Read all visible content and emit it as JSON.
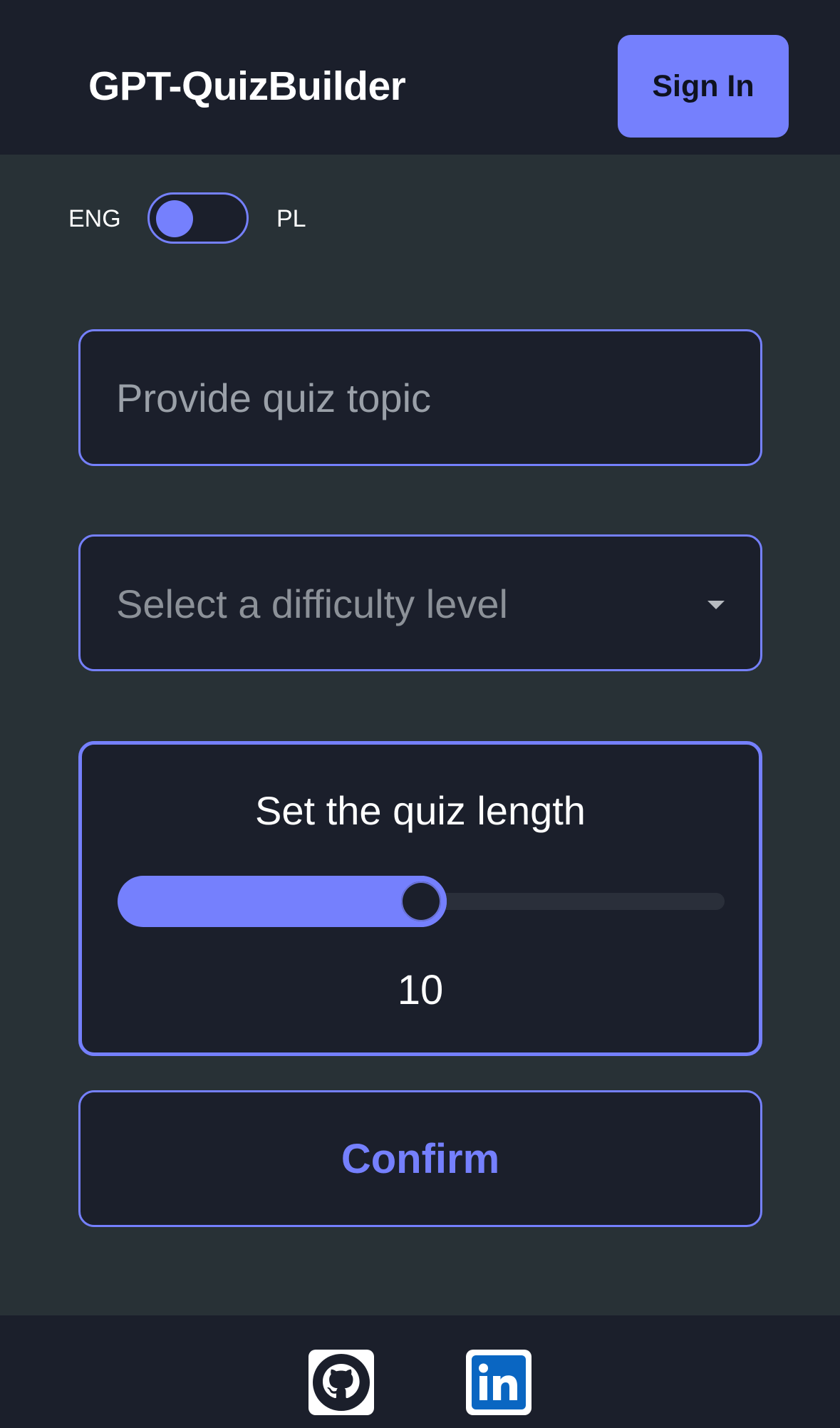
{
  "header": {
    "app_title": "GPT-QuizBuilder",
    "sign_in_label": "Sign In"
  },
  "language": {
    "left_label": "ENG",
    "right_label": "PL",
    "selected": "ENG"
  },
  "form": {
    "topic": {
      "placeholder": "Provide quiz topic",
      "value": ""
    },
    "difficulty": {
      "placeholder": "Select a difficulty level"
    },
    "length": {
      "title": "Set the quiz length",
      "value": "10",
      "fill_fraction": 0.5
    },
    "confirm_label": "Confirm"
  },
  "footer": {
    "links": [
      {
        "icon": "github-icon"
      },
      {
        "icon": "linkedin-icon"
      }
    ]
  },
  "colors": {
    "accent": "#7580fd",
    "header_bg": "#1b1f2b",
    "page_bg": "#283136"
  }
}
